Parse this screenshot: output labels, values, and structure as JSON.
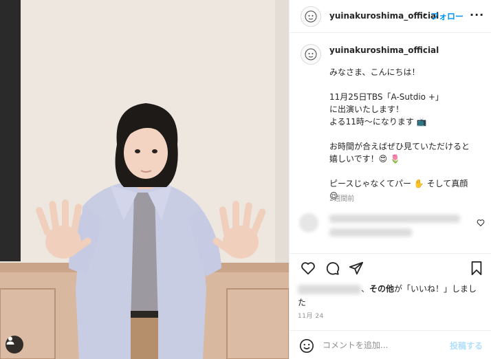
{
  "post": {
    "username": "yuinakuroshima_official",
    "dot": "•",
    "follow_label": "フォロー",
    "more_label": "···"
  },
  "caption": {
    "username": "yuinakuroshima_official",
    "lines": [
      "みなさま、こんにちは！",
      "",
      "11月25日TBS「A-Sutdio +」",
      "に出演いたします！",
      "よる11時〜になります 📺",
      "",
      "お時間が合えばぜひ見ていただけると",
      "嬉しいです！😍 🌷",
      "",
      "ピースじゃなくてパー ✋ そして真顔",
      "😌"
    ],
    "time_ago": "2週間前"
  },
  "likes": {
    "suffix": "、",
    "others_label": "その他",
    "tail": "が「いいね！」しまし",
    "tail2": "た"
  },
  "date": "11月 24",
  "comment": {
    "placeholder": "コメントを追加...",
    "post_label": "投稿する",
    "emoji_icon": "smiley-icon"
  },
  "icons": {
    "like": "heart-icon",
    "comment": "comment-icon",
    "share": "paper-plane-icon",
    "save": "bookmark-icon",
    "user_tag": "user-tag-icon"
  },
  "colors": {
    "accent": "#0095f6",
    "post_disabled": "#b2dffc",
    "muted": "#8e8e8e",
    "text": "#262626"
  }
}
